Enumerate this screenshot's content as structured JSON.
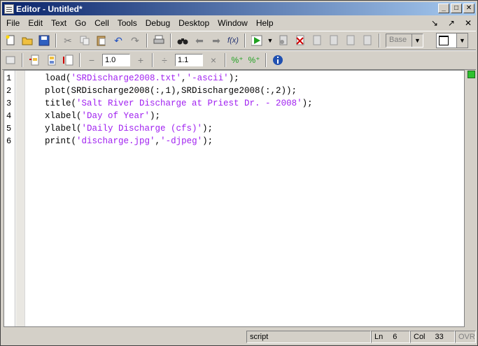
{
  "window": {
    "title": "Editor - Untitled*"
  },
  "title_controls": {
    "minimize": "_",
    "maximize": "□",
    "close": "✕"
  },
  "menu": {
    "items": [
      "File",
      "Edit",
      "Text",
      "Go",
      "Cell",
      "Tools",
      "Debug",
      "Desktop",
      "Window",
      "Help"
    ],
    "dock_left": "↘",
    "dock_right": "↗",
    "dock_close": "✕"
  },
  "toolbar1": {
    "stack_select": "Base",
    "fx_label": "f(x)"
  },
  "toolbar2": {
    "minus": "−",
    "cell_value_a": "1.0",
    "plus": "+",
    "divide": "÷",
    "cell_value_b": "1.1",
    "times": "×"
  },
  "editor": {
    "line_numbers": [
      "1",
      "2",
      "3",
      "4",
      "5",
      "6"
    ],
    "lines": [
      {
        "pre": "load(",
        "str1": "'SRDischarge2008.txt'",
        "mid": ",",
        "str2": "'-ascii'",
        "post": ");"
      },
      {
        "pre": "plot(SRDischarge2008(:,1),SRDischarge2008(:,2));",
        "str1": "",
        "mid": "",
        "str2": "",
        "post": ""
      },
      {
        "pre": "title(",
        "str1": "'Salt River Discharge at Priest Dr. - 2008'",
        "mid": "",
        "str2": "",
        "post": ");"
      },
      {
        "pre": "xlabel(",
        "str1": "'Day of Year'",
        "mid": "",
        "str2": "",
        "post": ");"
      },
      {
        "pre": "ylabel(",
        "str1": "'Daily Discharge (cfs)'",
        "mid": "",
        "str2": "",
        "post": ");"
      },
      {
        "pre": "print(",
        "str1": "'discharge.jpg'",
        "mid": ",",
        "str2": "'-djpeg'",
        "post": ");"
      }
    ]
  },
  "status": {
    "mode": "script",
    "ln_label": "Ln",
    "ln_value": "6",
    "col_label": "Col",
    "col_value": "33",
    "ovr": "OVR"
  },
  "colors": {
    "string": "#a020f0",
    "title_start": "#0a246a",
    "title_end": "#a6caf0",
    "green_indicator": "#2fc12f"
  }
}
